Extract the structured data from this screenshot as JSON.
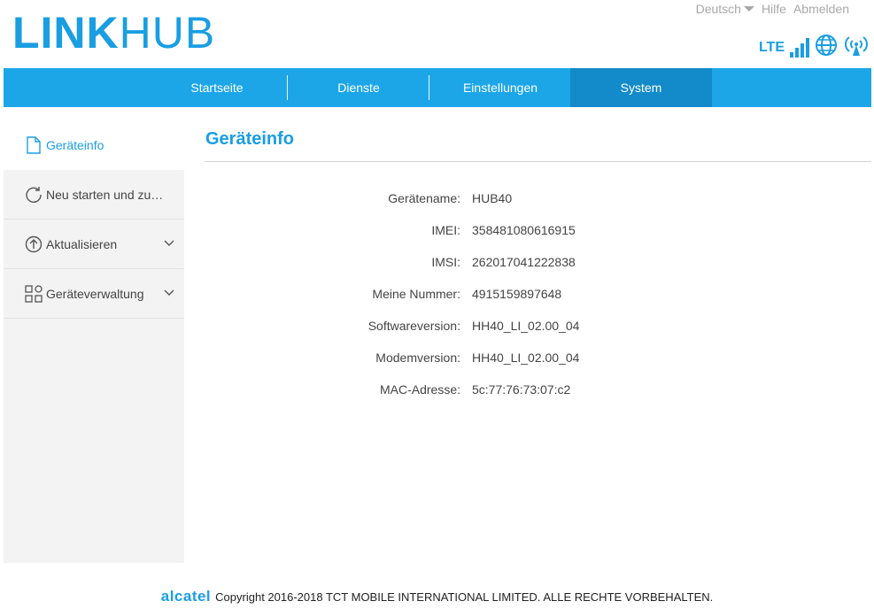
{
  "header": {
    "logo_bold": "LINK",
    "logo_light": "HUB",
    "language": "Deutsch",
    "help": "Hilfe",
    "logout": "Abmelden",
    "network_type": "LTE",
    "signal_icon": "signal-bars-icon",
    "globe_icon": "globe-icon",
    "wifi_icon": "wifi-broadcast-icon",
    "accent_color": "#1a9ee2"
  },
  "nav": {
    "tabs": [
      {
        "label": "Startseite",
        "active": false
      },
      {
        "label": "Dienste",
        "active": false
      },
      {
        "label": "Einstellungen",
        "active": false
      },
      {
        "label": "System",
        "active": true
      }
    ],
    "bar_color": "#1ca6e8",
    "active_color": "#138ac9"
  },
  "sidebar": {
    "items": [
      {
        "label": "Geräteinfo",
        "icon": "document-icon",
        "active": true
      },
      {
        "label": "Neu starten und zu…",
        "icon": "refresh-icon",
        "active": false
      },
      {
        "label": "Aktualisieren",
        "icon": "upload-arrow-icon",
        "expandable": true
      },
      {
        "label": "Geräteverwaltung",
        "icon": "grid-icon",
        "expandable": true
      }
    ]
  },
  "main": {
    "title": "Geräteinfo",
    "rows": [
      {
        "label": "Gerätename:",
        "value": "HUB40"
      },
      {
        "label": "IMEI:",
        "value": "358481080616915"
      },
      {
        "label": "IMSI:",
        "value": "262017041222838"
      },
      {
        "label": "Meine Nummer:",
        "value": "4915159897648"
      },
      {
        "label": "Softwareversion:",
        "value": "HH40_LI_02.00_04"
      },
      {
        "label": "Modemversion:",
        "value": "HH40_LI_02.00_04"
      },
      {
        "label": "MAC-Adresse:",
        "value": "5c:77:76:73:07:c2"
      }
    ]
  },
  "footer": {
    "brand": "alcatel",
    "copyright": "Copyright 2016-2018 TCT MOBILE INTERNATIONAL LIMITED. ALLE RECHTE VORBEHALTEN."
  }
}
